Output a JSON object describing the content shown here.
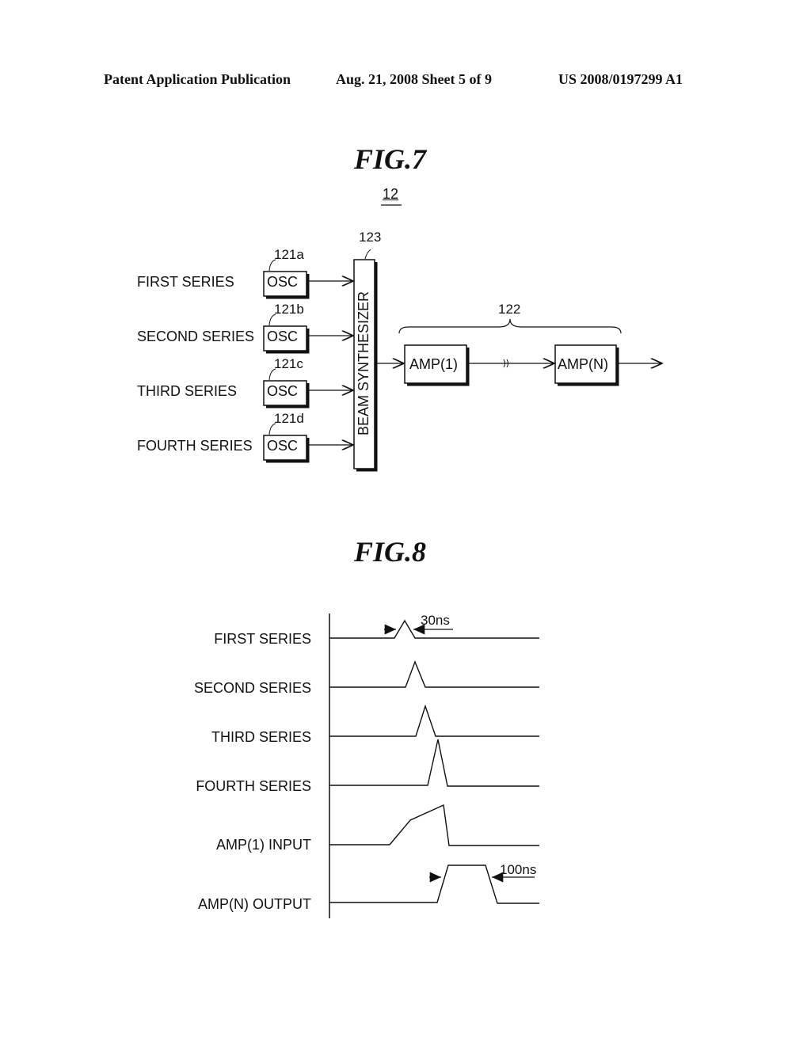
{
  "header": {
    "left": "Patent Application Publication",
    "middle": "Aug. 21, 2008  Sheet 5 of 9",
    "right": "US 2008/0197299 A1"
  },
  "fig7": {
    "title": "FIG.7",
    "ref": "12",
    "synth_ref": "123",
    "synth_label": "BEAM SYNTHESIZER",
    "amp_group_ref": "122",
    "series": [
      {
        "label": "FIRST SERIES",
        "osc": "OSC",
        "ref": "121a"
      },
      {
        "label": "SECOND SERIES",
        "osc": "OSC",
        "ref": "121b"
      },
      {
        "label": "THIRD SERIES",
        "osc": "OSC",
        "ref": "121c"
      },
      {
        "label": "FOURTH SERIES",
        "osc": "OSC",
        "ref": "121d"
      }
    ],
    "amps": [
      "AMP(1)",
      "AMP(N)"
    ]
  },
  "fig8": {
    "title": "FIG.8",
    "rows": [
      "FIRST SERIES",
      "SECOND SERIES",
      "THIRD SERIES",
      "FOURTH SERIES",
      "AMP(1) INPUT",
      "AMP(N) OUTPUT"
    ],
    "annotations": {
      "pulse_width": "30ns",
      "output_width": "100ns"
    }
  }
}
